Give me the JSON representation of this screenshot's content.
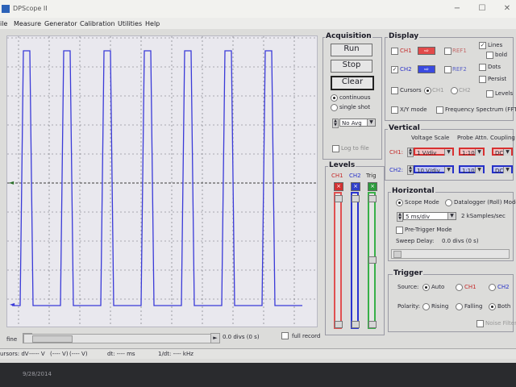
{
  "window": {
    "title": "DPScope II",
    "min": "−",
    "max": "☐",
    "close": "✕"
  },
  "menu": [
    "ile",
    "Measure",
    "Generator",
    "Calibration",
    "Utilities",
    "Help"
  ],
  "scope": {
    "ch1_color": "#3a3ad8",
    "trigger_marker": "◄",
    "channel_marker": "◄",
    "time_label": "0.0 divs (0 s)",
    "full_record": "full record",
    "fine": "fine"
  },
  "acquisition": {
    "title": "Acquisition",
    "run": "Run",
    "stop": "Stop",
    "clear": "Clear",
    "continuous": "continuous",
    "single_shot": "single shot",
    "avg": "No Avg",
    "log": "Log to file"
  },
  "display": {
    "title": "Display",
    "ch1": "CH1",
    "ch2": "CH2",
    "ref1": "REF1",
    "ref2": "REF2",
    "arrow": "⇨",
    "lines": "Lines",
    "bold": "bold",
    "dots": "Dots",
    "persist": "Persist",
    "levels": "Levels",
    "cursors": "Cursors",
    "cur_ch1": "CH1",
    "cur_ch2": "CH2",
    "xy": "X/Y mode",
    "fft": "Frequency Spectrum (FFT)"
  },
  "vertical": {
    "title": "Vertical",
    "voltage_scale": "Voltage Scale",
    "probe_attn": "Probe Attn.",
    "coupling": "Coupling",
    "ch1": "CH1:",
    "ch2": "CH2:",
    "ch1_scale": "1 V/div",
    "ch2_scale": "10 V/div",
    "ch1_probe": "1:10",
    "ch2_probe": "1:10",
    "ch1_coupling": "DC",
    "ch2_coupling": "DC",
    "ch1_color": "#d83030",
    "ch2_color": "#2530c8"
  },
  "levels": {
    "title": "Levels",
    "ch1": "CH1",
    "ch2": "CH2",
    "trig": "Trig",
    "x": "×"
  },
  "horizontal": {
    "title": "Horizontal",
    "scope_mode": "Scope Mode",
    "datalogger": "Datalogger (Roll) Mode",
    "timebase": "5 ms/div",
    "samplerate": "2 kSamples/sec",
    "pretrigger": "Pre-Trigger Mode",
    "sweep_delay_label": "Sweep Delay:",
    "sweep_delay_value": "0.0 divs (0 s)"
  },
  "trigger": {
    "title": "Trigger",
    "source": "Source:",
    "auto": "Auto",
    "ch1": "CH1",
    "ch2": "CH2",
    "polarity": "Polarity:",
    "rising": "Rising",
    "falling": "Falling",
    "both": "Both",
    "noise": "Noise Filter"
  },
  "status": {
    "cursors": "ursors: dV",
    "v1": "----- V",
    "v2": "(---- V)",
    "v3": "(---- V)",
    "dt": "dt: ---- ms",
    "f": "1/dt: ---- kHz"
  },
  "taskbar": {
    "date": "9/28/2014"
  }
}
